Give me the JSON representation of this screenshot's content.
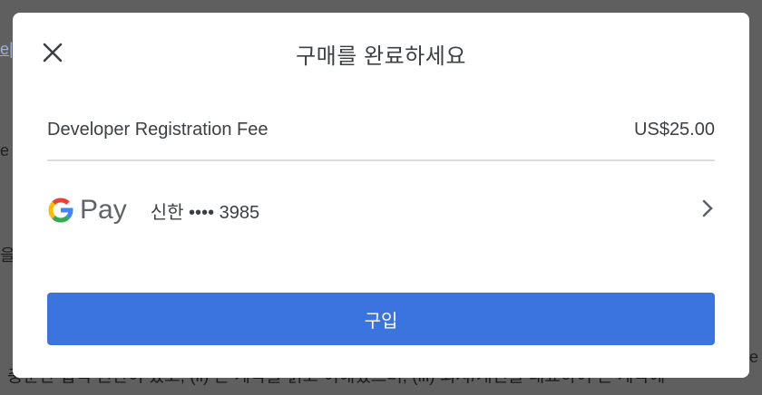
{
  "background": {
    "link_fragment": "e|",
    "frag1": "e l",
    "frag2": "을",
    "frag3": "ole",
    "bottom_text": "충분한 법적 권한이 있고, (ii) 본 계약을 읽고 이해했으며, (iii) 회사/개인을 대표하여 본 계약에"
  },
  "dialog": {
    "title": "구매를 완료하세요",
    "close_icon": "close-icon",
    "item": {
      "name": "Developer Registration Fee",
      "price": "US$25.00"
    },
    "payment": {
      "method_text": "Pay",
      "card": "신한 •••• 3985",
      "chevron_icon": "chevron-right-icon"
    },
    "buy_label": "구입"
  },
  "colors": {
    "accent": "#3b73df"
  }
}
